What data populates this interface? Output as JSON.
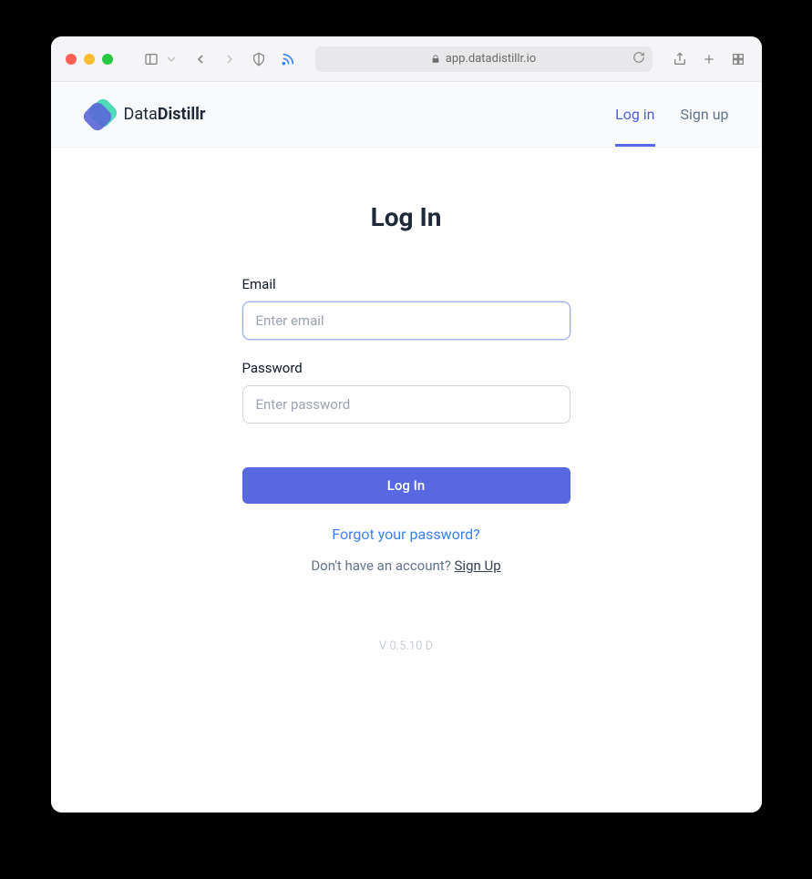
{
  "browser": {
    "url": "app.datadistillr.io"
  },
  "logo": {
    "text_light": "Data",
    "text_bold": "Distillr"
  },
  "nav": {
    "login": "Log in",
    "signup": "Sign up"
  },
  "page": {
    "title": "Log In"
  },
  "form": {
    "email": {
      "label": "Email",
      "placeholder": "Enter email",
      "value": ""
    },
    "password": {
      "label": "Password",
      "placeholder": "Enter password",
      "value": ""
    },
    "submit": "Log In",
    "forgot": "Forgot your password?",
    "no_account": "Don't have an account? ",
    "signup_link": "Sign Up"
  },
  "version": "V 0.5.10 D"
}
